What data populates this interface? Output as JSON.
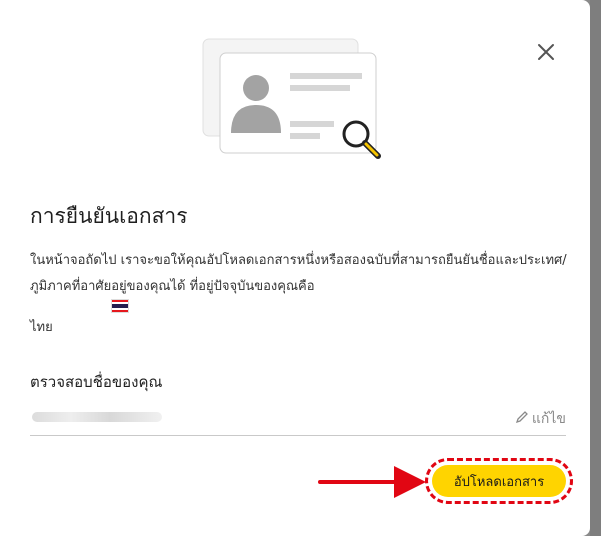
{
  "dialog": {
    "title": "การยืนยันเอกสาร",
    "description": "ในหน้าจอถัดไป เราจะขอให้คุณอัปโหลดเอกสารหนึ่งหรือสองฉบับที่สามารถยืนยันชื่อและประเทศ/ภูมิภาคที่อาศัยอยู่ของคุณได้ ที่อยู่ปัจจุบันของคุณคือ",
    "country": "ไทย",
    "flag_icon": "thailand-flag-icon",
    "close_icon": "close-icon"
  },
  "name_section": {
    "title": "ตรวจสอบชื่อของคุณ",
    "edit_label": "แก้ไข",
    "edit_icon": "pencil-icon"
  },
  "actions": {
    "upload_label": "อัปโหลดเอกสาร"
  },
  "colors": {
    "primary_button": "#ffd400",
    "highlight": "#e10613"
  }
}
